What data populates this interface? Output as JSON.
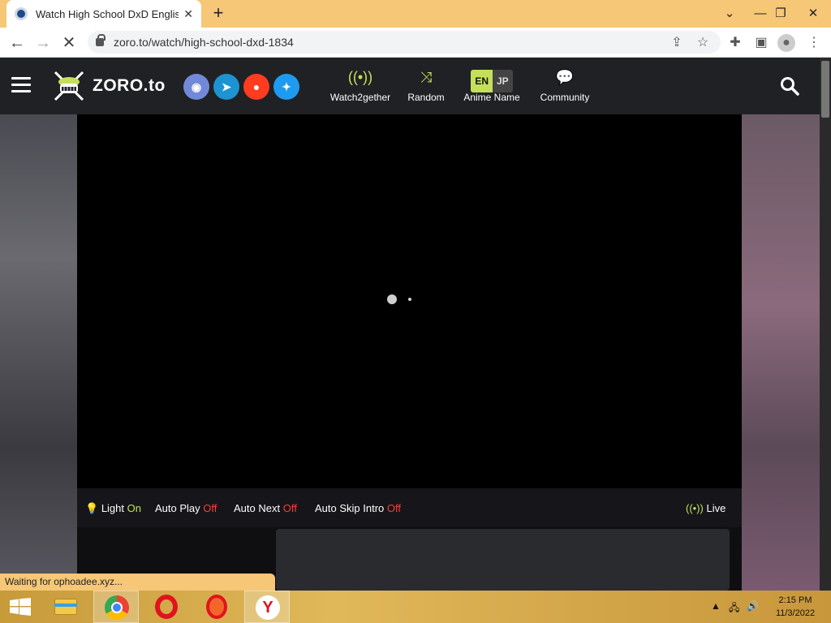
{
  "browser": {
    "tab_title": "Watch High School DxD English S",
    "tab_close": "✕",
    "new_tab": "+",
    "url": "zoro.to/watch/high-school-dxd-1834",
    "status_text": "Waiting for ophoadee.xyz..."
  },
  "site": {
    "logo_text": "ZORO.to",
    "social": [
      {
        "name": "discord",
        "color": "#7289da"
      },
      {
        "name": "telegram",
        "color": "#1d93d2"
      },
      {
        "name": "reddit",
        "color": "#ff3c1f"
      },
      {
        "name": "twitter",
        "color": "#1d9bf0"
      }
    ],
    "nav": {
      "watch2gether": "Watch2gether",
      "random": "Random",
      "anime_name": "Anime Name",
      "lang_en": "EN",
      "lang_jp": "JP",
      "community": "Community"
    }
  },
  "player_controls": {
    "light_label": "Light",
    "light_value": "On",
    "autoplay_label": "Auto Play",
    "autoplay_value": "Off",
    "autonext_label": "Auto Next",
    "autonext_value": "Off",
    "autoskip_label": "Auto Skip Intro",
    "autoskip_value": "Off",
    "live_label": "Live"
  },
  "taskbar": {
    "time": "2:15 PM",
    "date": "11/3/2022"
  },
  "colors": {
    "accent": "#c4e05a",
    "off": "#ff3b3b",
    "header_bg": "#202125"
  }
}
